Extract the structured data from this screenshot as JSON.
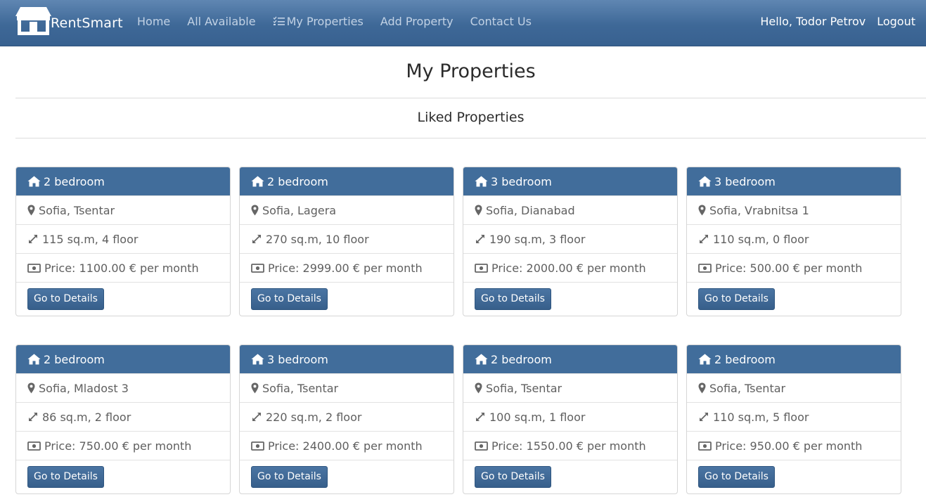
{
  "nav": {
    "brand": "RentSmart",
    "links": [
      {
        "label": "Home"
      },
      {
        "label": "All Available"
      },
      {
        "label": "My Properties"
      },
      {
        "label": "Add Property"
      },
      {
        "label": "Contact Us"
      }
    ],
    "greeting": "Hello, Todor Petrov",
    "logout": "Logout"
  },
  "page_title": "My Properties",
  "section_title": "Liked Properties",
  "details_label": "Go to Details",
  "cards": [
    {
      "title": "2 bedroom",
      "location": "Sofia, Tsentar",
      "size": "115 sq.m, 4 floor",
      "price": "Price: 1100.00 € per month"
    },
    {
      "title": "2 bedroom",
      "location": "Sofia, Lagera",
      "size": "270 sq.m, 10 floor",
      "price": "Price: 2999.00 € per month"
    },
    {
      "title": "3 bedroom",
      "location": "Sofia, Dianabad",
      "size": "190 sq.m, 3 floor",
      "price": "Price: 2000.00 € per month"
    },
    {
      "title": "3 bedroom",
      "location": "Sofia, Vrabnitsa 1",
      "size": "110 sq.m, 0 floor",
      "price": "Price: 500.00 € per month"
    },
    {
      "title": "2 bedroom",
      "location": "Sofia, Mladost 3",
      "size": "86 sq.m, 2 floor",
      "price": "Price: 750.00 € per month"
    },
    {
      "title": "3 bedroom",
      "location": "Sofia, Tsentar",
      "size": "220 sq.m, 2 floor",
      "price": "Price: 2400.00 € per month"
    },
    {
      "title": "2 bedroom",
      "location": "Sofia, Tsentar",
      "size": "100 sq.m, 1 floor",
      "price": "Price: 1550.00 € per month"
    },
    {
      "title": "2 bedroom",
      "location": "Sofia, Tsentar",
      "size": "110 sq.m, 5 floor",
      "price": "Price: 950.00 € per month"
    }
  ],
  "colors": {
    "navbar": "#416d9b",
    "card_header": "#416d9b",
    "button": "#3e6897",
    "nav_link": "#c2d2e5"
  },
  "icons": {
    "brand": "shop-icon",
    "my_properties": "list-check-icon",
    "card_title": "home-icon",
    "location": "map-marker-icon",
    "size": "expand-arrows-icon",
    "price": "money-bill-icon"
  }
}
